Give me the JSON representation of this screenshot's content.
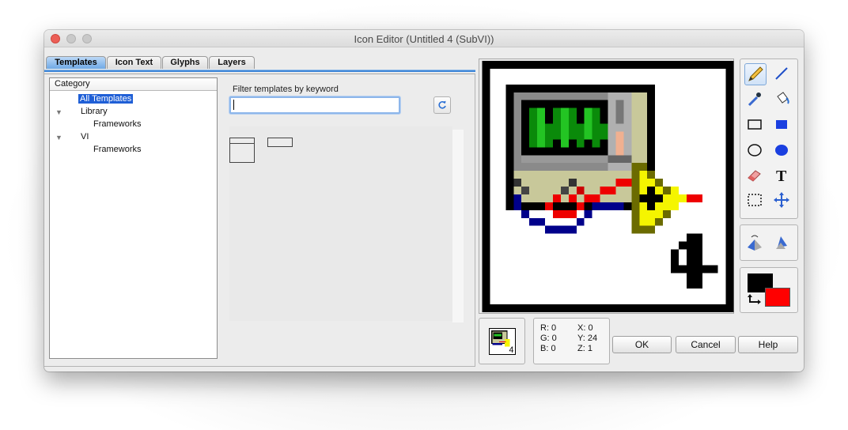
{
  "window": {
    "title": "Icon Editor (Untitled 4 (SubVI))"
  },
  "tabs": [
    {
      "label": "Templates",
      "active": true
    },
    {
      "label": "Icon Text",
      "active": false
    },
    {
      "label": "Glyphs",
      "active": false
    },
    {
      "label": "Layers",
      "active": false
    }
  ],
  "category": {
    "header": "Category",
    "items": {
      "all_templates": "All Templates",
      "library": "Library",
      "library_frameworks": "Frameworks",
      "vi": "VI",
      "vi_frameworks": "Frameworks"
    }
  },
  "filter": {
    "label": "Filter templates by keyword",
    "value": "",
    "refresh_icon": "refresh-icon"
  },
  "tools": [
    "pencil-icon",
    "line-icon",
    "dropper-icon",
    "fill-bucket-icon",
    "rectangle-icon",
    "filled-rectangle-icon",
    "ellipse-icon",
    "filled-ellipse-icon",
    "eraser-icon",
    "text-icon",
    "select-icon",
    "move-icon"
  ],
  "colors": {
    "foreground": "#000000",
    "background": "#ff0000",
    "accent": "#3e86d8"
  },
  "info": {
    "r": "R: 0",
    "g": "G: 0",
    "b": "B: 0",
    "x": "X: 0",
    "y": "Y: 24",
    "z": "Z: 1"
  },
  "buttons": {
    "ok": "OK",
    "cancel": "Cancel",
    "help": "Help"
  },
  "icon": {
    "number": "4"
  }
}
